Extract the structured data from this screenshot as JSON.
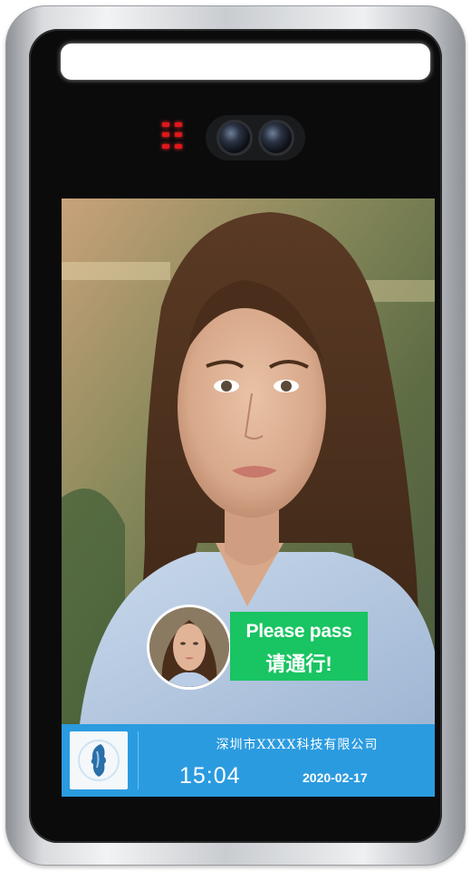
{
  "status": {
    "message_en": "Please pass",
    "message_cn": "请通行!",
    "color": "#19c462"
  },
  "info_bar": {
    "company": "深圳市XXXX科技有限公司",
    "time": "15:04",
    "date": "2020-02-17",
    "color": "#2b9be0"
  },
  "device": {
    "led_color": "#e0171b"
  },
  "icons": {
    "logo": "face-logo-icon",
    "camera": "dual-camera-icon",
    "ir": "ir-led-icon"
  }
}
